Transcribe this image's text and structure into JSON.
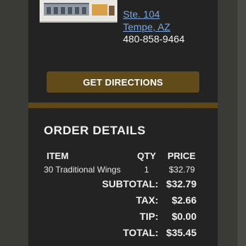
{
  "location": {
    "address_line2": "Ste. 104",
    "address_line3": "Tempe, AZ",
    "phone": "480-858-9464",
    "directions_label": "GET DIRECTIONS"
  },
  "order": {
    "title": "ORDER DETAILS",
    "columns": {
      "item": "ITEM",
      "qty": "QTY",
      "price": "PRICE"
    },
    "items": [
      {
        "name": "30 Traditional Wings",
        "qty": "1",
        "price": "$32.79"
      }
    ],
    "summary": {
      "subtotal_label": "SUBTOTAL:",
      "subtotal_value": "$32.79",
      "tax_label": "TAX:",
      "tax_value": "$2.66",
      "tip_label": "TIP:",
      "tip_value": "$0.00",
      "total_label": "TOTAL:",
      "total_value": "$35.45"
    }
  },
  "colors": {
    "background": "#232323",
    "accent_gold": "#624b1b",
    "divider_gold": "#5e4817",
    "link_blue": "#7fa6d8",
    "text": "#f0f0f0"
  }
}
